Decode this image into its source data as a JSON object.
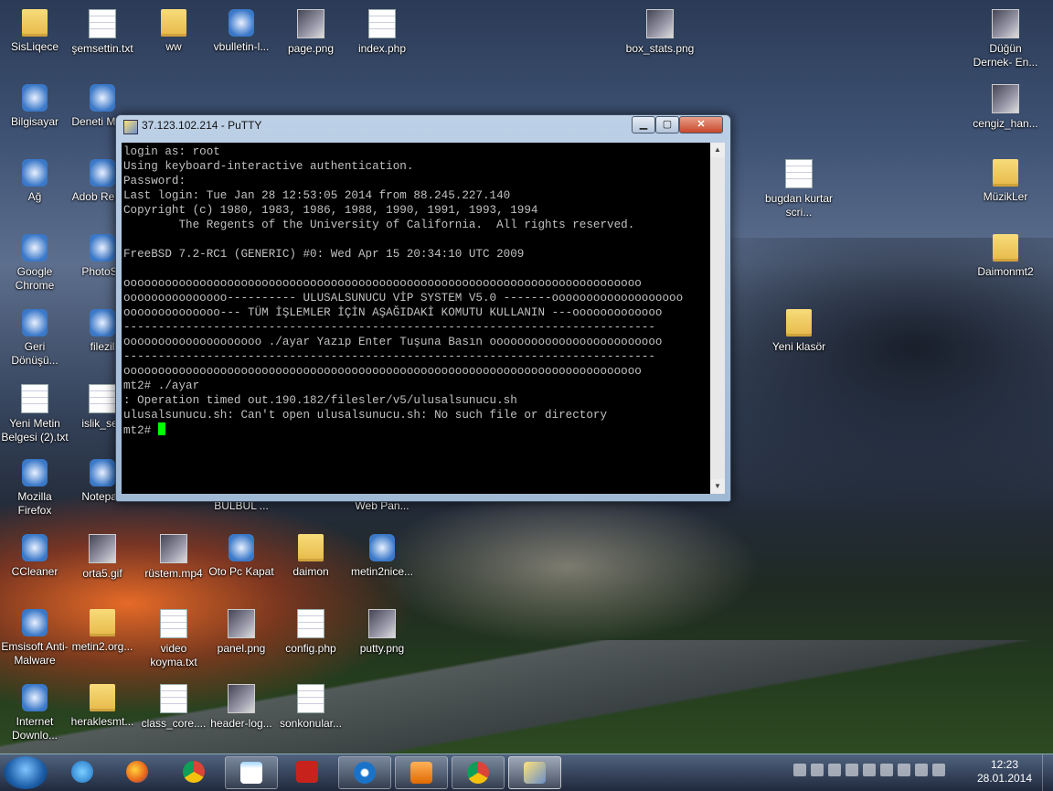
{
  "desktop_icons": [
    {
      "label": "SisLiqece",
      "kind": "folder"
    },
    {
      "label": "şemsettin.txt",
      "kind": "doc"
    },
    {
      "label": "ww",
      "kind": "folder"
    },
    {
      "label": "vbulletin-l...",
      "kind": "app"
    },
    {
      "label": "page.png",
      "kind": "img"
    },
    {
      "label": "index.php",
      "kind": "doc"
    },
    {
      "label": "box_stats.png",
      "kind": "img"
    },
    {
      "label": "Düğün Dernek- En...",
      "kind": "img"
    },
    {
      "label": "Bilgisayar",
      "kind": "app"
    },
    {
      "label": "Deneti Masa",
      "kind": "app"
    },
    {
      "label": "cengiz_han...",
      "kind": "img"
    },
    {
      "label": "Ağ",
      "kind": "app"
    },
    {
      "label": "Adob Reade",
      "kind": "app"
    },
    {
      "label": "bugdan kurtar scri...",
      "kind": "doc"
    },
    {
      "label": "MüzikLer",
      "kind": "folder"
    },
    {
      "label": "Google Chrome",
      "kind": "app"
    },
    {
      "label": "PhotoSc",
      "kind": "app"
    },
    {
      "label": "Daimonmt2",
      "kind": "folder"
    },
    {
      "label": "Geri Dönüşü...",
      "kind": "app"
    },
    {
      "label": "filezil",
      "kind": "app"
    },
    {
      "label": "Yeni klasör",
      "kind": "folder"
    },
    {
      "label": "Yeni Metin Belgesi (2).txt",
      "kind": "doc"
    },
    {
      "label": "islik_ses",
      "kind": "doc"
    },
    {
      "label": "Mozilla Firefox",
      "kind": "app"
    },
    {
      "label": "Notepad",
      "kind": "app"
    },
    {
      "label": "BULBUL ...",
      "kind": "none"
    },
    {
      "label": "Web Pan...",
      "kind": "none"
    },
    {
      "label": "CCleaner",
      "kind": "app"
    },
    {
      "label": "orta5.gif",
      "kind": "img"
    },
    {
      "label": "rüstem.mp4",
      "kind": "img"
    },
    {
      "label": "Oto Pc Kapat",
      "kind": "app"
    },
    {
      "label": "daimon",
      "kind": "folder"
    },
    {
      "label": "metin2nice...",
      "kind": "app"
    },
    {
      "label": "Emsisoft Anti-Malware",
      "kind": "app"
    },
    {
      "label": "metin2.org...",
      "kind": "folder"
    },
    {
      "label": "video koyma.txt",
      "kind": "doc"
    },
    {
      "label": "panel.png",
      "kind": "img"
    },
    {
      "label": "config.php",
      "kind": "doc"
    },
    {
      "label": "putty.png",
      "kind": "img"
    },
    {
      "label": "Internet Downlo...",
      "kind": "app"
    },
    {
      "label": "heraklesmt...",
      "kind": "folder"
    },
    {
      "label": "class_core....",
      "kind": "doc"
    },
    {
      "label": "header-log...",
      "kind": "img"
    },
    {
      "label": "sonkonular...",
      "kind": "doc"
    }
  ],
  "putty": {
    "title": "37.123.102.214 - PuTTY",
    "terminal_lines": [
      "login as: root",
      "Using keyboard-interactive authentication.",
      "Password:",
      "Last login: Tue Jan 28 12:53:05 2014 from 88.245.227.140",
      "Copyright (c) 1980, 1983, 1986, 1988, 1990, 1991, 1993, 1994",
      "        The Regents of the University of California.  All rights reserved.",
      "",
      "FreeBSD 7.2-RC1 (GENERIC) #0: Wed Apr 15 20:34:10 UTC 2009",
      "",
      "ooooooooooooooooooooooooooooooooooooooooooooooooooooooooooooooooooooooooooo",
      "ooooooooooooooo---------- ULUSALSUNUCU VİP SYSTEM V5.0 -------ooooooooooooooooooo",
      "oooooooooooooo--- TÜM İŞLEMLER İÇİN AŞAĞIDAKİ KOMUTU KULLANIN ---ooooooooooooo",
      "-----------------------------------------------------------------------------",
      "oooooooooooooooooooo ./ayar Yazıp Enter Tuşuna Basın ooooooooooooooooooooooooo",
      "-----------------------------------------------------------------------------",
      "ooooooooooooooooooooooooooooooooooooooooooooooooooooooooooooooooooooooooooo",
      "mt2# ./ayar",
      ": Operation timed out.190.182/filesler/v5/ulusalsunucu.sh",
      "ulusalsunucu.sh: Can't open ulusalsunucu.sh: No such file or directory"
    ],
    "prompt": "mt2# "
  },
  "taskbar": {
    "clock_time": "12:23",
    "clock_date": "28.01.2014"
  }
}
